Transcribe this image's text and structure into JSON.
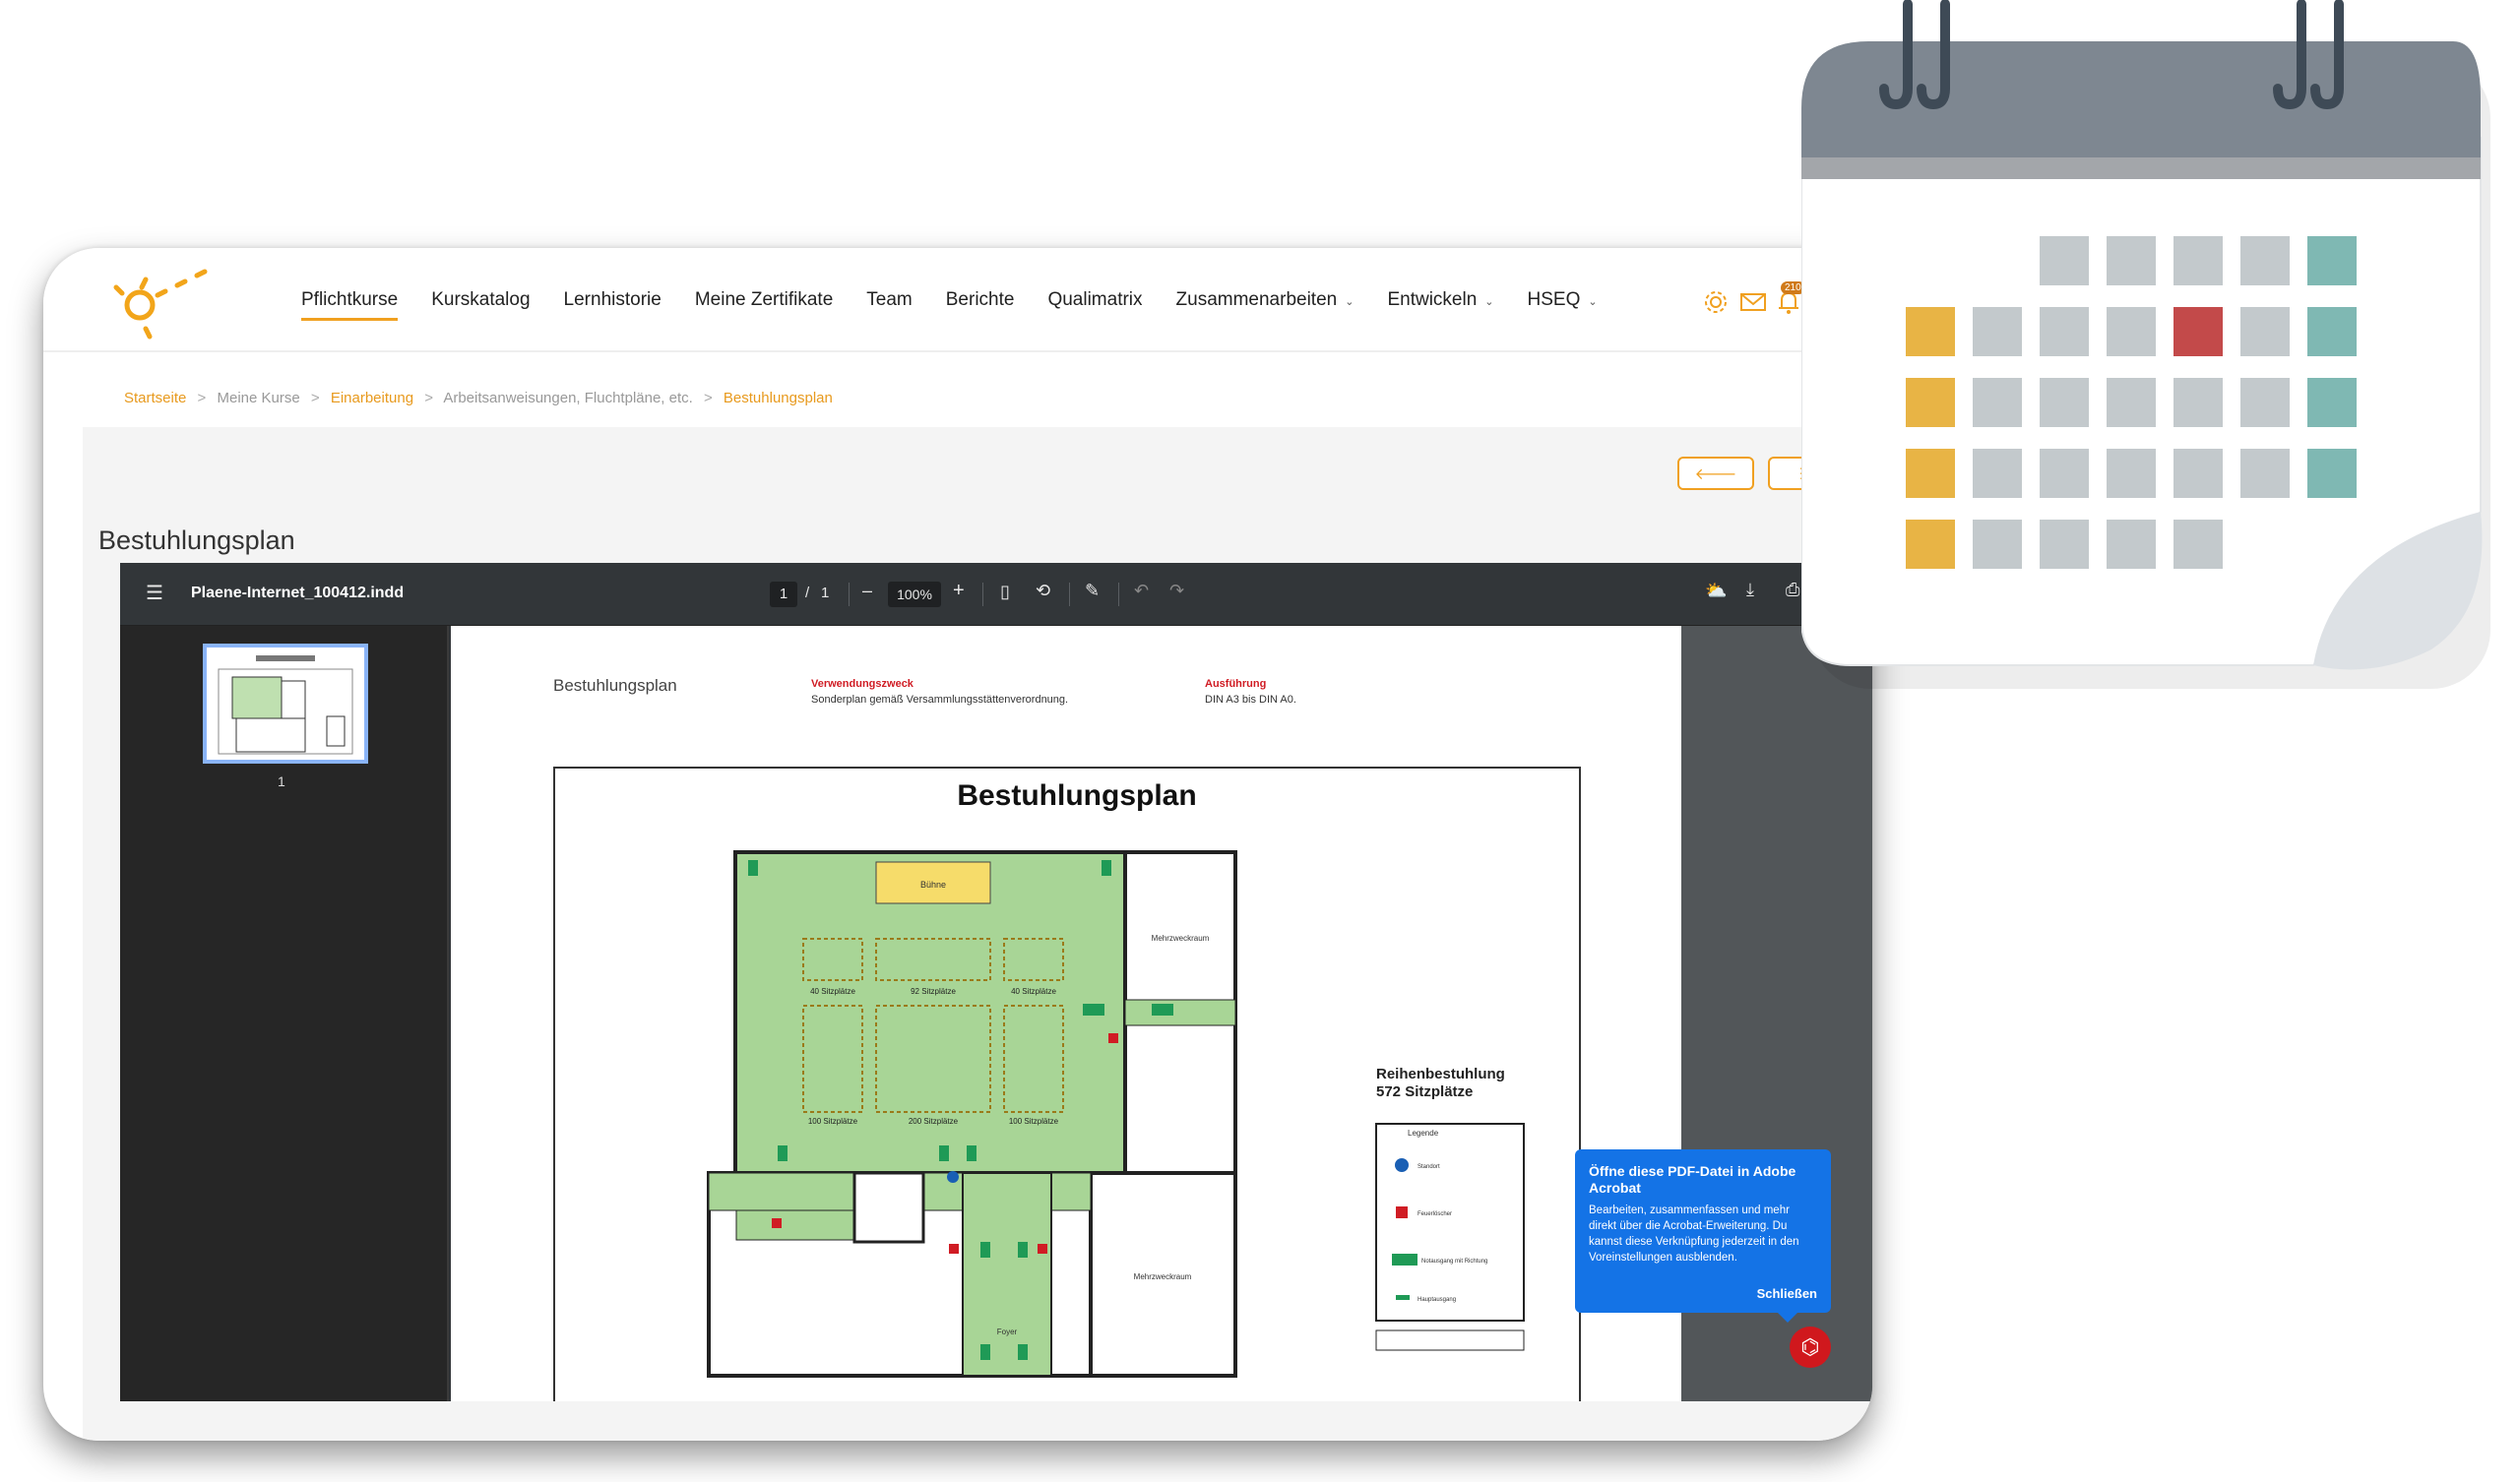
{
  "nav": {
    "items": [
      {
        "label": "Pflichtkurse",
        "active": true,
        "dropdown": false
      },
      {
        "label": "Kurskatalog",
        "active": false,
        "dropdown": false
      },
      {
        "label": "Lernhistorie",
        "active": false,
        "dropdown": false
      },
      {
        "label": "Meine Zertifikate",
        "active": false,
        "dropdown": false
      },
      {
        "label": "Team",
        "active": false,
        "dropdown": false
      },
      {
        "label": "Berichte",
        "active": false,
        "dropdown": false
      },
      {
        "label": "Qualimatrix",
        "active": false,
        "dropdown": false
      },
      {
        "label": "Zusammenarbeiten",
        "active": false,
        "dropdown": true
      },
      {
        "label": "Entwickeln",
        "active": false,
        "dropdown": true
      },
      {
        "label": "HSEQ",
        "active": false,
        "dropdown": true
      }
    ],
    "icons": [
      "gear-icon",
      "mail-icon",
      "bell-icon"
    ],
    "notification_count": "210",
    "accent_color": "#f0a020"
  },
  "breadcrumb": [
    {
      "label": "Startseite",
      "link": true
    },
    {
      "label": "Meine Kurse",
      "link": false
    },
    {
      "label": "Einarbeitung",
      "link": true
    },
    {
      "label": "Arbeitsanweisungen, Fluchtpläne, etc.",
      "link": false
    },
    {
      "label": "Bestuhlungsplan",
      "link": true
    }
  ],
  "breadcrumb_separator": ">",
  "page": {
    "title": "Bestuhlungsplan",
    "back_icon": "arrow-left-icon",
    "list_icon": "list-icon"
  },
  "pdf_viewer": {
    "document_name": "Plaene-Internet_100412.indd",
    "current_page": "1",
    "page_separator": "/",
    "total_pages": "1",
    "zoom": "100%",
    "zoom_out_label": "–",
    "zoom_in_label": "+",
    "thumbnail_page_number": "1"
  },
  "pdf_content": {
    "header_title": "Bestuhlungsplan",
    "purpose_label": "Verwendungszweck",
    "purpose_text": "Sonderplan gemäß Versammlungsstättenverordnung.",
    "execution_label": "Ausführung",
    "execution_text": "DIN A3 bis DIN A0.",
    "plan_title": "Bestuhlungsplan",
    "stage_label": "Bühne",
    "seat_blocks": [
      "40 Sitzplätze",
      "92 Sitzplätze",
      "40 Sitzplätze",
      "100 Sitzplätze",
      "200 Sitzplätze",
      "100 Sitzplätze"
    ],
    "room_label_1": "Mehrzweckraum",
    "room_label_2": "Mehrzweckraum",
    "foyer_label": "Foyer",
    "summary_title": "Reihenbestuhlung",
    "summary_seats": "572 Sitzplätze",
    "legend_title": "Legende",
    "legend_items": [
      "Standort",
      "Feuerlöscher",
      "Notausgang mit Richtung",
      "Hauptausgang"
    ]
  },
  "acrobat_tooltip": {
    "title": "Öffne diese PDF-Datei in Adobe Acrobat",
    "body": "Bearbeiten, zusammenfassen und mehr direkt über die Acrobat-Erweiterung. Du kannst diese Verknüpfung jederzeit in den Voreinstellungen ausblenden.",
    "close_label": "Schließen",
    "icon": "acrobat-icon"
  },
  "calendar_decoration": {
    "colors": {
      "header": "#7e8791",
      "stripe": "#a3a6aa",
      "yellow": "#e8b445",
      "gray": "#c3c9cc",
      "red": "#c34a4a",
      "teal": "#7fb8b3"
    }
  }
}
